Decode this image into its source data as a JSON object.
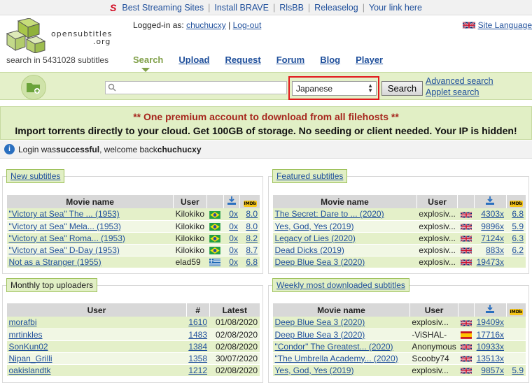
{
  "topbar": {
    "links": [
      "Best Streaming Sites",
      "Install BRAVE",
      "RlsBB",
      "Releaselog",
      "Your link here"
    ]
  },
  "header": {
    "logo_main": "opensubtitles",
    "logo_org": ".org",
    "tagline": "search in 5431028 subtitles",
    "logged_in_prefix": "Logged-in as:",
    "username": "chuchucxy",
    "logout": "Log-out",
    "site_language": "Site Language"
  },
  "nav": {
    "items": [
      "Search",
      "Upload",
      "Request",
      "Forum",
      "Blog",
      "Player"
    ]
  },
  "search": {
    "placeholder": "",
    "language_selected": "Japanese",
    "button_label": "Search",
    "advanced": "Advanced search",
    "applet": "Applet search"
  },
  "promo": {
    "line1": "** One premium account to download from all filehosts **",
    "line2": "Import torrents directly to your cloud. Get 100GB of storage. No seeding or client needed. Your IP is hidden!"
  },
  "welcome": {
    "pre": "Login was ",
    "bold": "successful",
    "mid": ", welcome back ",
    "user": "chuchucxy"
  },
  "new_subtitles": {
    "title": "New subtitles",
    "headers": {
      "movie": "Movie name",
      "user": "User",
      "imdb": "IMDb"
    },
    "rows": [
      {
        "movie": "\"Victory at Sea\" The ... (1953)",
        "user": "Kilokiko",
        "flag": "brazil",
        "dl": "0x",
        "imdb": "8.0"
      },
      {
        "movie": "\"Victory at Sea\" Mela... (1953)",
        "user": "Kilokiko",
        "flag": "brazil",
        "dl": "0x",
        "imdb": "8.0"
      },
      {
        "movie": "\"Victory at Sea\" Roma... (1953)",
        "user": "Kilokiko",
        "flag": "brazil",
        "dl": "0x",
        "imdb": "8.2"
      },
      {
        "movie": "\"Victory at Sea\" D-Day (1953)",
        "user": "Kilokiko",
        "flag": "brazil",
        "dl": "0x",
        "imdb": "8.7"
      },
      {
        "movie": "Not as a Stranger (1955)",
        "user": "elad59",
        "flag": "greece",
        "dl": "0x",
        "imdb": "6.8"
      }
    ]
  },
  "featured_subtitles": {
    "title": "Featured subtitles",
    "headers": {
      "movie": "Movie name",
      "user": "User",
      "imdb": "IMDb"
    },
    "rows": [
      {
        "movie": "The Secret: Dare to ... (2020)",
        "user": "explosiv...",
        "flag": "uk",
        "dl": "4303x",
        "imdb": "6.8"
      },
      {
        "movie": "Yes, God, Yes (2019)",
        "user": "explosiv...",
        "flag": "uk",
        "dl": "9896x",
        "imdb": "5.9"
      },
      {
        "movie": "Legacy of Lies (2020)",
        "user": "explosiv...",
        "flag": "uk",
        "dl": "7124x",
        "imdb": "6.3"
      },
      {
        "movie": "Dead Dicks (2019)",
        "user": "explosiv...",
        "flag": "uk",
        "dl": "883x",
        "imdb": "6.2"
      },
      {
        "movie": "Deep Blue Sea 3 (2020)",
        "user": "explosiv...",
        "flag": "uk",
        "dl": "19473x",
        "imdb": ""
      }
    ]
  },
  "monthly_uploaders": {
    "title": "Monthly top uploaders",
    "headers": {
      "user": "User",
      "count": "#",
      "latest": "Latest"
    },
    "rows": [
      {
        "user": "morafbi",
        "count": "1610",
        "latest": "01/08/2020"
      },
      {
        "user": "mrtinkles",
        "count": "1483",
        "latest": "02/08/2020"
      },
      {
        "user": "SonKun02",
        "count": "1384",
        "latest": "02/08/2020"
      },
      {
        "user": "Nipan_Grilli",
        "count": "1358",
        "latest": "30/07/2020"
      },
      {
        "user": "oakislandtk",
        "count": "1212",
        "latest": "02/08/2020"
      }
    ]
  },
  "weekly_downloaded": {
    "title": "Weekly most downloaded subtitles",
    "headers": {
      "movie": "Movie name",
      "user": "User",
      "imdb": "IMDb"
    },
    "rows": [
      {
        "movie": "Deep Blue Sea 3 (2020)",
        "user": "explosiv...",
        "flag": "uk",
        "dl": "19409x",
        "imdb": ""
      },
      {
        "movie": "Deep Blue Sea 3 (2020)",
        "user": "-ViSHAL-",
        "flag": "spain",
        "dl": "17716x",
        "imdb": ""
      },
      {
        "movie": "\"Condor\" The Greatest... (2020)",
        "user": "Anonymous",
        "flag": "uk",
        "dl": "10933x",
        "imdb": ""
      },
      {
        "movie": "\"The Umbrella Academy... (2020)",
        "user": "Scooby74",
        "flag": "uk",
        "dl": "13513x",
        "imdb": ""
      },
      {
        "movie": "Yes, God, Yes (2019)",
        "user": "explosiv...",
        "flag": "uk",
        "dl": "9857x",
        "imdb": "5.9"
      }
    ]
  }
}
